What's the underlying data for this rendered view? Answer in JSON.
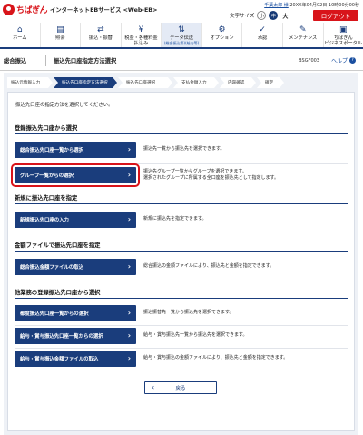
{
  "header": {
    "brand": "ちばぎん",
    "service": "インターネットEBサービス <Web-EB>",
    "user_name": "千葉太郎 様",
    "last_login": "20XX年04月02日 10時00分00秒",
    "font_size_label": "文字サイズ",
    "font_small": "小",
    "font_medium": "中",
    "font_large": "大",
    "logout": "ログアウト"
  },
  "nav": [
    {
      "label": "ホーム",
      "icon": "home-icon",
      "glyph": "⌂"
    },
    {
      "label": "照会",
      "icon": "document-search-icon",
      "glyph": "▤"
    },
    {
      "label": "振込・振替",
      "icon": "transfer-icon",
      "glyph": "⇄"
    },
    {
      "label": "税金・各種料金",
      "label2": "払込み",
      "icon": "tax-payment-icon",
      "glyph": "¥"
    },
    {
      "label": "データ伝送",
      "sub": "(総合振込等)(給与等)",
      "icon": "data-transfer-icon",
      "glyph": "⇅",
      "active": true
    },
    {
      "label": "オプション",
      "icon": "option-gear-icon",
      "glyph": "⚙"
    },
    {
      "label": "承認",
      "icon": "approval-icon",
      "glyph": "✓"
    },
    {
      "label": "メンテナンス",
      "icon": "maintenance-icon",
      "glyph": "✎"
    },
    {
      "label": "ちばぎん",
      "label2": "ビジネスポータル",
      "icon": "business-portal-icon",
      "glyph": "▣"
    }
  ],
  "titlebar": {
    "category": "総合振込",
    "title": "振込先口座指定方法選択",
    "screen_id": "BSGF003",
    "help": "ヘルプ",
    "help_icon": "help-icon"
  },
  "steps": [
    {
      "label": "振込元情報入力"
    },
    {
      "label": "振込先口座指定方法選択",
      "active": true
    },
    {
      "label": "振込先口座選択"
    },
    {
      "label": "支払金額入力"
    },
    {
      "label": "内容確認"
    },
    {
      "label": "確定"
    }
  ],
  "intro": "振込先口座の指定方法を選択してください。",
  "sections": [
    {
      "title": "登録振込先口座から選択",
      "rows": [
        {
          "button": "総合振込先口座一覧から選択",
          "desc": "振込先一覧から振込先を選択できます。"
        },
        {
          "button": "グループ一覧からの選択",
          "desc": "振込先グループ一覧からグループを選択できます。",
          "desc2": "選択されたグループに所属する全口座を振込先として指定します。",
          "highlight": true
        }
      ]
    },
    {
      "title": "新規に振込先口座を指定",
      "rows": [
        {
          "button": "新規振込先口座の入力",
          "desc": "新規に振込先を指定できます。"
        }
      ]
    },
    {
      "title": "金額ファイルで振込先口座を指定",
      "rows": [
        {
          "button": "総合振込金額ファイルの取込",
          "desc": "総合振込の金額ファイルにより、振込先と金額を指定できます。"
        }
      ]
    },
    {
      "title": "他業務の登録振込先口座から選択",
      "rows": [
        {
          "button": "都度振込先口座一覧からの選択",
          "desc": "振込振替先一覧から振込先を選択できます。"
        },
        {
          "button": "給与・賞与振込先口座一覧からの選択",
          "desc": "給与・賞与振込先一覧から振込先を選択できます。"
        },
        {
          "button": "給与・賞与振込金額ファイルの取込",
          "desc": "給与・賞与振込の金額ファイルにより、振込先と金額を指定できます。"
        }
      ]
    }
  ],
  "back_button": "戻る",
  "colors": {
    "brand_red": "#d8141a",
    "navy": "#1a3d7c",
    "bg": "#eef1f6"
  }
}
